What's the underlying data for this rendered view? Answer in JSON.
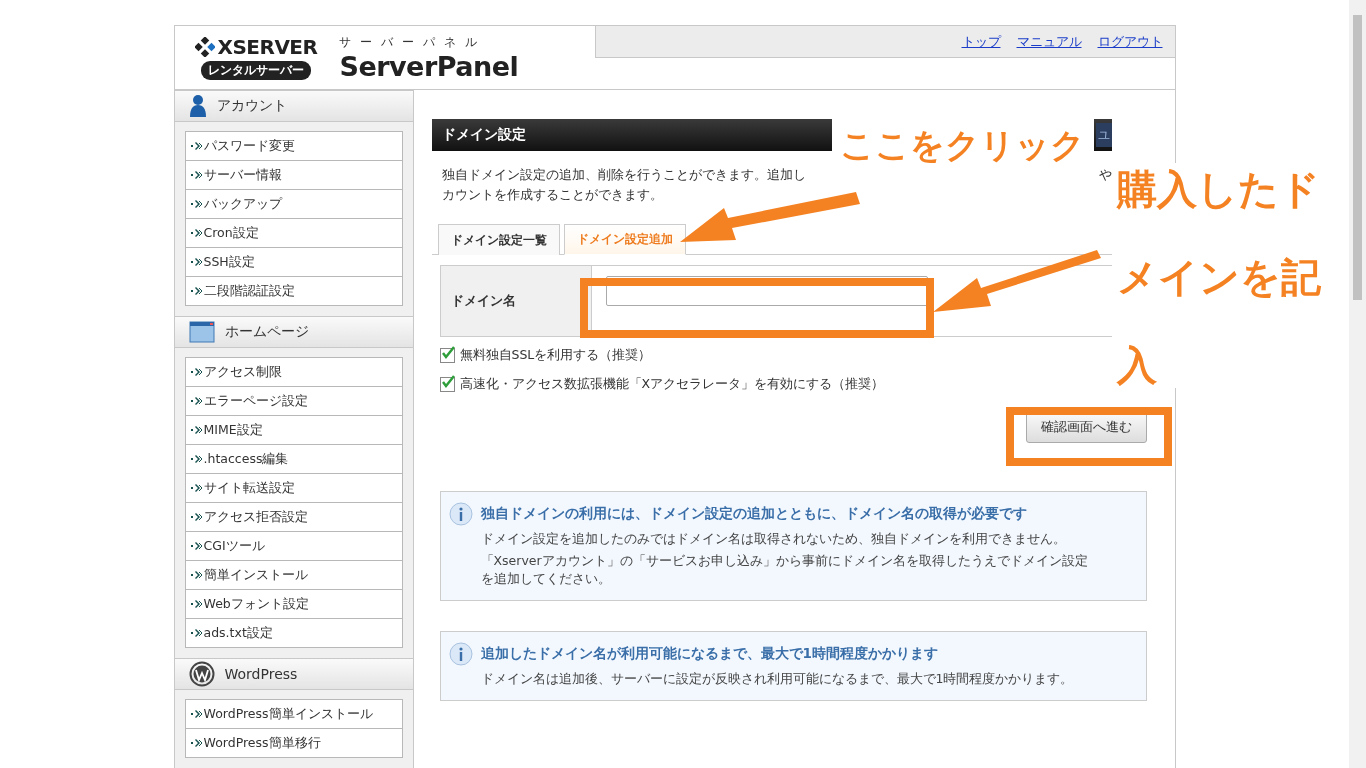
{
  "header": {
    "logo_brand": "XSERVER",
    "logo_badge": "レンタルサーバー",
    "panel_kana": "サーバーパネル",
    "panel_name": "ServerPanel",
    "nav_links": [
      "トップ",
      "マニュアル",
      "ログアウト"
    ]
  },
  "sidebar": {
    "sections": [
      {
        "title": "アカウント",
        "kind": "person",
        "items": [
          "パスワード変更",
          "サーバー情報",
          "バックアップ",
          "Cron設定",
          "SSH設定",
          "二段階認証設定"
        ]
      },
      {
        "title": "ホームページ",
        "kind": "window",
        "items": [
          "アクセス制限",
          "エラーページ設定",
          "MIME設定",
          ".htaccess編集",
          "サイト転送設定",
          "アクセス拒否設定",
          "CGIツール",
          "簡単インストール",
          "Webフォント設定",
          "ads.txt設定"
        ]
      },
      {
        "title": "WordPress",
        "kind": "wordpress",
        "items": [
          "WordPress簡単インストール",
          "WordPress簡単移行"
        ]
      }
    ]
  },
  "main": {
    "title": "ドメイン設定",
    "title_button": "ユ",
    "description": {
      "line_1_start": "独自ドメイン設定の追加、削除を行うことができます。追加し",
      "line_1_end": "や",
      "line_2": "カウントを作成することができます。"
    },
    "tabs": [
      {
        "label": "ドメイン設定一覧",
        "selected": false
      },
      {
        "label": "ドメイン設定追加",
        "selected": true
      }
    ],
    "form": {
      "label": "ドメイン名"
    },
    "options": [
      {
        "label": "無料独自SSLを利用する（推奨）",
        "checked": true
      },
      {
        "label": "高速化・アクセス数拡張機能「Xアクセラレータ」を有効にする（推奨）",
        "checked": true
      }
    ],
    "submit": "確認画面へ進む",
    "notices": [
      {
        "title": "独自ドメインの利用には、ドメイン設定の追加とともに、ドメイン名の取得が必要です",
        "paragraphs": [
          "ドメイン設定を追加したのみではドメイン名は取得されないため、独自ドメインを利用できません。",
          "「Xserverアカウント」の「サービスお申し込み」から事前にドメイン名を取得したうえでドメイン設定を追加してください。"
        ]
      },
      {
        "title": "追加したドメイン名が利用可能になるまで、最大で1時間程度かかります",
        "paragraphs": [
          "ドメイン名は追加後、サーバーに設定が反映され利用可能になるまで、最大で1時間程度かかります。"
        ]
      }
    ]
  },
  "annotations": {
    "click_callout": "ここをクリック",
    "enter_callout_lines": [
      "購入したド",
      "メインを記",
      "入"
    ]
  }
}
